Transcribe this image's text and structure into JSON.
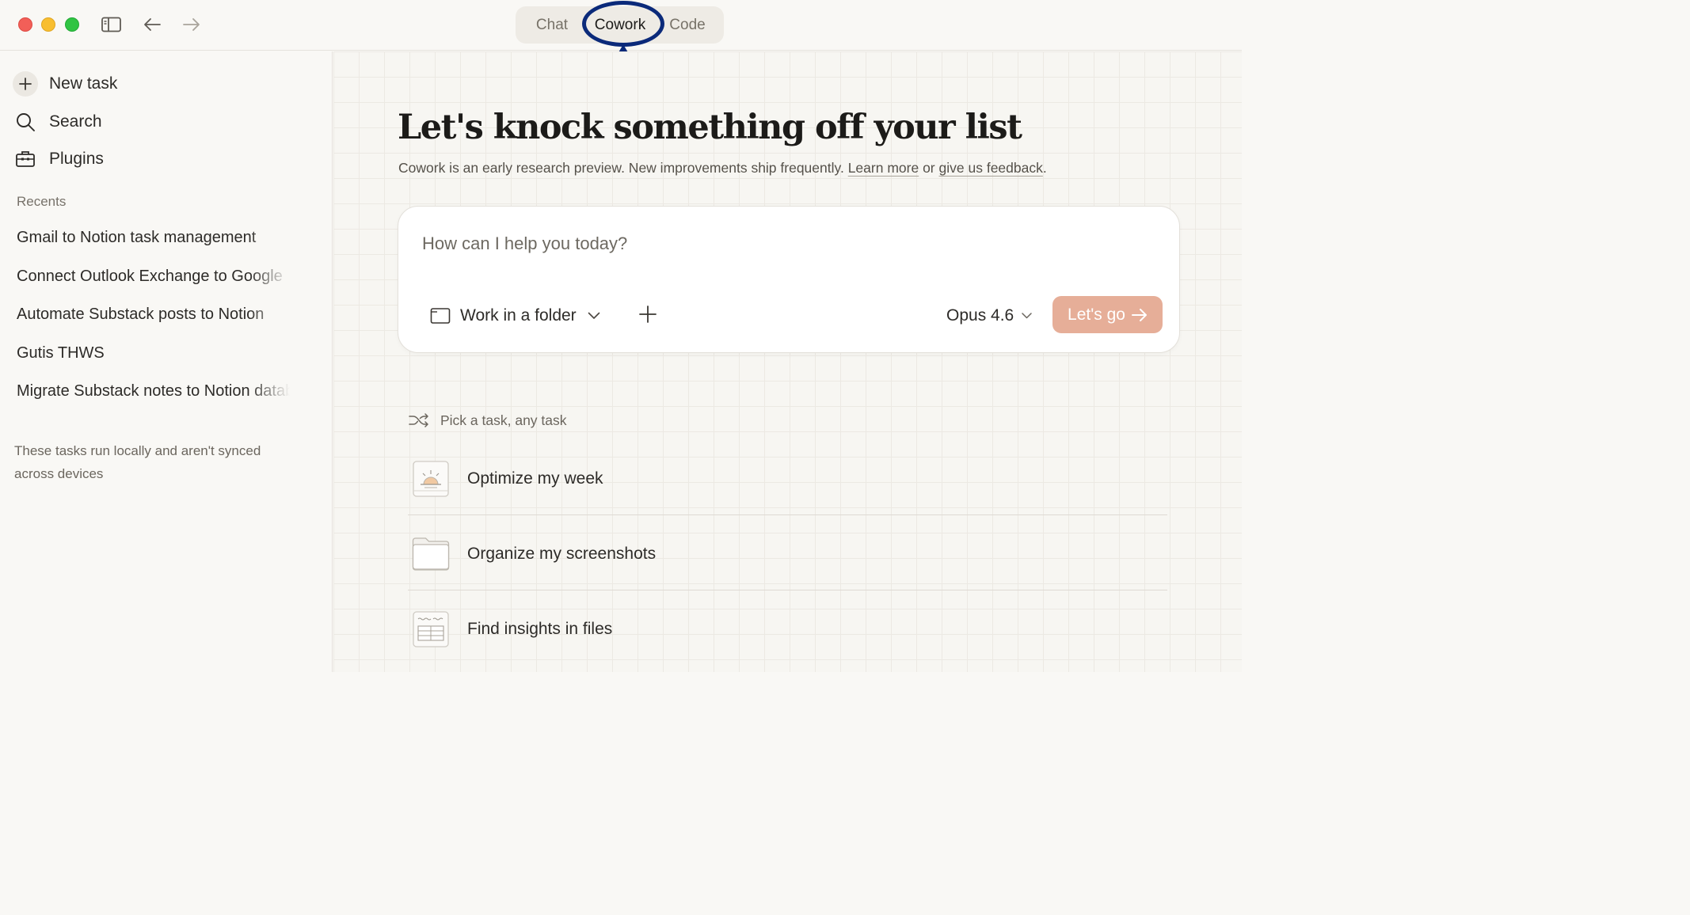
{
  "window": {
    "mode_tabs": [
      "Chat",
      "Cowork",
      "Code"
    ],
    "active_mode": "Cowork"
  },
  "sidebar": {
    "nav": {
      "new_task": "New task",
      "search": "Search",
      "plugins": "Plugins"
    },
    "recents_label": "Recents",
    "recents": [
      "Gmail to Notion task management",
      "Connect Outlook Exchange to Google",
      "Automate Substack posts to Notion",
      "Gutis THWS",
      "Migrate Substack notes to Notion database"
    ],
    "footer_note": "These tasks run locally and aren't synced across devices"
  },
  "main": {
    "headline": "Let's knock something off your list",
    "subline": {
      "text": "Cowork is an early research preview. New improvements ship frequently.",
      "learn_more": "Learn more",
      "or": "or",
      "feedback": "give us feedback",
      "period": "."
    },
    "prompt": {
      "placeholder": "How can I help you today?",
      "folder_label": "Work in a folder",
      "model": "Opus 4.6",
      "go_label": "Let's go"
    },
    "pick_label": "Pick a task, any task",
    "tasks": [
      {
        "label": "Optimize my week",
        "icon": "sunrise-calendar-icon"
      },
      {
        "label": "Organize my screenshots",
        "icon": "folder-icon"
      },
      {
        "label": "Find insights in files",
        "icon": "spreadsheet-icon"
      }
    ]
  },
  "colors": {
    "annotation": "#0b2a7a",
    "go_button": "#e6ae98",
    "background": "#f9f8f5"
  }
}
